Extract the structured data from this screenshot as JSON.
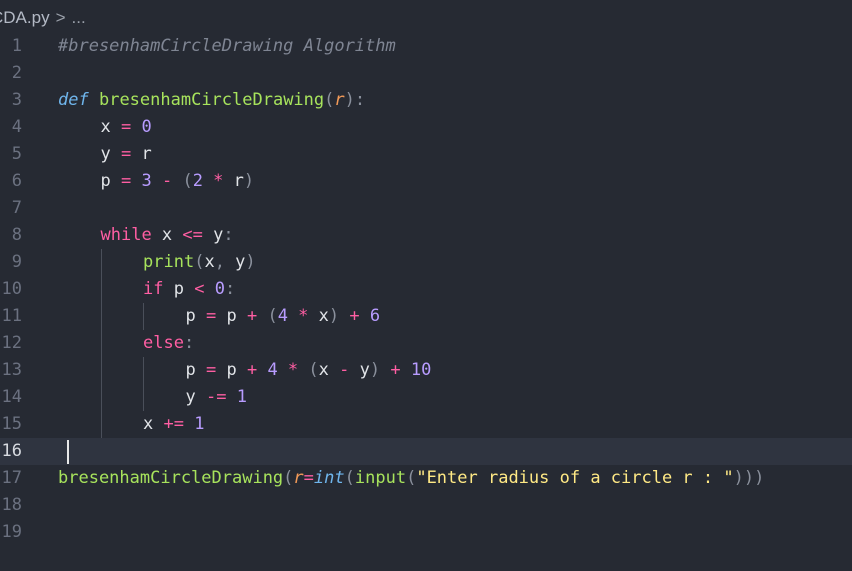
{
  "breadcrumb": {
    "file": "CDA.py",
    "separator": ">",
    "more": "..."
  },
  "editor": {
    "current_line": 16,
    "lines": [
      {
        "n": "1",
        "indent": 0,
        "tokens": [
          {
            "t": "#bresenhamCircleDrawing Algorithm",
            "c": "comment"
          }
        ]
      },
      {
        "n": "2",
        "indent": 0,
        "tokens": []
      },
      {
        "n": "3",
        "indent": 0,
        "tokens": [
          {
            "t": "def",
            "c": "kw-def"
          },
          {
            "t": " ",
            "c": "var"
          },
          {
            "t": "bresenhamCircleDrawing",
            "c": "fn"
          },
          {
            "t": "(",
            "c": "paren"
          },
          {
            "t": "r",
            "c": "param"
          },
          {
            "t": "):",
            "c": "paren"
          }
        ]
      },
      {
        "n": "4",
        "indent": 1,
        "tokens": [
          {
            "t": "x",
            "c": "var"
          },
          {
            "t": " = ",
            "c": "op"
          },
          {
            "t": "0",
            "c": "num"
          }
        ]
      },
      {
        "n": "5",
        "indent": 1,
        "tokens": [
          {
            "t": "y",
            "c": "var"
          },
          {
            "t": " = ",
            "c": "op"
          },
          {
            "t": "r",
            "c": "var"
          }
        ]
      },
      {
        "n": "6",
        "indent": 1,
        "tokens": [
          {
            "t": "p",
            "c": "var"
          },
          {
            "t": " = ",
            "c": "op"
          },
          {
            "t": "3",
            "c": "num"
          },
          {
            "t": " - ",
            "c": "op"
          },
          {
            "t": "(",
            "c": "paren"
          },
          {
            "t": "2",
            "c": "num"
          },
          {
            "t": " * ",
            "c": "op"
          },
          {
            "t": "r",
            "c": "var"
          },
          {
            "t": ")",
            "c": "paren"
          }
        ]
      },
      {
        "n": "7",
        "indent": 1,
        "tokens": []
      },
      {
        "n": "8",
        "indent": 1,
        "tokens": [
          {
            "t": "while",
            "c": "kw"
          },
          {
            "t": " x ",
            "c": "var"
          },
          {
            "t": "<=",
            "c": "op"
          },
          {
            "t": " y",
            "c": "var"
          },
          {
            "t": ":",
            "c": "paren"
          }
        ]
      },
      {
        "n": "9",
        "indent": 2,
        "tokens": [
          {
            "t": "print",
            "c": "bi"
          },
          {
            "t": "(",
            "c": "paren"
          },
          {
            "t": "x",
            "c": "var"
          },
          {
            "t": ", ",
            "c": "paren"
          },
          {
            "t": "y",
            "c": "var"
          },
          {
            "t": ")",
            "c": "paren"
          }
        ]
      },
      {
        "n": "10",
        "indent": 2,
        "tokens": [
          {
            "t": "if",
            "c": "kw"
          },
          {
            "t": " p ",
            "c": "var"
          },
          {
            "t": "<",
            "c": "op"
          },
          {
            "t": " ",
            "c": "var"
          },
          {
            "t": "0",
            "c": "num"
          },
          {
            "t": ":",
            "c": "paren"
          }
        ]
      },
      {
        "n": "11",
        "indent": 3,
        "tokens": [
          {
            "t": "p",
            "c": "var"
          },
          {
            "t": " = ",
            "c": "op"
          },
          {
            "t": "p",
            "c": "var"
          },
          {
            "t": " + ",
            "c": "op"
          },
          {
            "t": "(",
            "c": "paren"
          },
          {
            "t": "4",
            "c": "num"
          },
          {
            "t": " * ",
            "c": "op"
          },
          {
            "t": "x",
            "c": "var"
          },
          {
            "t": ")",
            "c": "paren"
          },
          {
            "t": " + ",
            "c": "op"
          },
          {
            "t": "6",
            "c": "num"
          }
        ]
      },
      {
        "n": "12",
        "indent": 2,
        "tokens": [
          {
            "t": "else",
            "c": "kw"
          },
          {
            "t": ":",
            "c": "paren"
          }
        ]
      },
      {
        "n": "13",
        "indent": 3,
        "tokens": [
          {
            "t": "p",
            "c": "var"
          },
          {
            "t": " = ",
            "c": "op"
          },
          {
            "t": "p",
            "c": "var"
          },
          {
            "t": " + ",
            "c": "op"
          },
          {
            "t": "4",
            "c": "num"
          },
          {
            "t": " * ",
            "c": "op"
          },
          {
            "t": "(",
            "c": "paren"
          },
          {
            "t": "x",
            "c": "var"
          },
          {
            "t": " - ",
            "c": "op"
          },
          {
            "t": "y",
            "c": "var"
          },
          {
            "t": ")",
            "c": "paren"
          },
          {
            "t": " + ",
            "c": "op"
          },
          {
            "t": "10",
            "c": "num"
          }
        ]
      },
      {
        "n": "14",
        "indent": 3,
        "tokens": [
          {
            "t": "y",
            "c": "var"
          },
          {
            "t": " -= ",
            "c": "op"
          },
          {
            "t": "1",
            "c": "num"
          }
        ]
      },
      {
        "n": "15",
        "indent": 2,
        "tokens": [
          {
            "t": "x",
            "c": "var"
          },
          {
            "t": " += ",
            "c": "op"
          },
          {
            "t": "1",
            "c": "num"
          }
        ]
      },
      {
        "n": "16",
        "indent": 0,
        "tokens": []
      },
      {
        "n": "17",
        "indent": 0,
        "tokens": [
          {
            "t": "bresenhamCircleDrawing",
            "c": "fn"
          },
          {
            "t": "(",
            "c": "paren"
          },
          {
            "t": "r",
            "c": "param"
          },
          {
            "t": "=",
            "c": "op"
          },
          {
            "t": "int",
            "c": "type"
          },
          {
            "t": "(",
            "c": "paren"
          },
          {
            "t": "input",
            "c": "bi"
          },
          {
            "t": "(",
            "c": "paren"
          },
          {
            "t": "\"Enter radius of a circle r : \"",
            "c": "str"
          },
          {
            "t": ")))",
            "c": "paren"
          }
        ]
      },
      {
        "n": "18",
        "indent": 0,
        "tokens": []
      },
      {
        "n": "19",
        "indent": 0,
        "tokens": []
      }
    ]
  },
  "colors": {
    "background": "#262a33",
    "current_line": "#2f3440",
    "comment": "#7f8593",
    "keyword": "#ff5ea3",
    "function": "#a7e35c",
    "number": "#b89cff",
    "string": "#ffe985",
    "parameter": "#f29a58",
    "type": "#6fb5ec"
  }
}
